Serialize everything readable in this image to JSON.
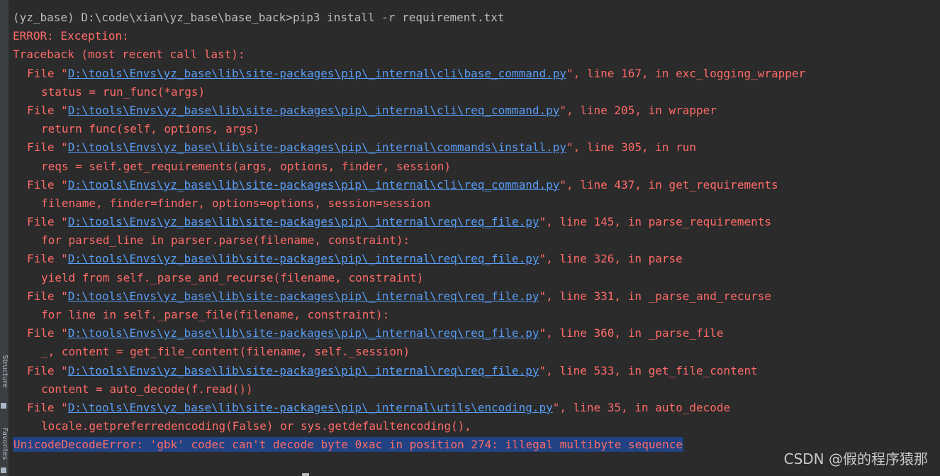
{
  "ide": {
    "left_tabs": [
      {
        "label": "Structure",
        "icon": "structure-icon"
      },
      {
        "label": "Favorites",
        "icon": "favorites-icon"
      }
    ]
  },
  "terminal": {
    "lines": [
      {
        "type": "prompt",
        "text": "(yz_base) D:\\code\\xian\\yz_base\\base_back>pip3 install -r requirement.txt"
      },
      {
        "type": "error",
        "text": "ERROR: Exception:"
      },
      {
        "type": "error",
        "text": "Traceback (most recent call last):"
      },
      {
        "type": "frame",
        "prefix": "File \"",
        "path": "D:\\tools\\Envs\\yz_base\\lib\\site-packages\\pip\\_internal\\cli\\base_command.py",
        "suffix": "\", line 167, in exc_logging_wrapper"
      },
      {
        "type": "code",
        "text": "status = run_func(*args)"
      },
      {
        "type": "frame",
        "prefix": "File \"",
        "path": "D:\\tools\\Envs\\yz_base\\lib\\site-packages\\pip\\_internal\\cli\\req_command.py",
        "suffix": "\", line 205, in wrapper"
      },
      {
        "type": "code",
        "text": "return func(self, options, args)"
      },
      {
        "type": "frame",
        "prefix": "File \"",
        "path": "D:\\tools\\Envs\\yz_base\\lib\\site-packages\\pip\\_internal\\commands\\install.py",
        "suffix": "\", line 305, in run"
      },
      {
        "type": "code",
        "text": "reqs = self.get_requirements(args, options, finder, session)"
      },
      {
        "type": "frame",
        "prefix": "File \"",
        "path": "D:\\tools\\Envs\\yz_base\\lib\\site-packages\\pip\\_internal\\cli\\req_command.py",
        "suffix": "\", line 437, in get_requirements"
      },
      {
        "type": "code",
        "text": "filename, finder=finder, options=options, session=session"
      },
      {
        "type": "frame",
        "prefix": "File \"",
        "path": "D:\\tools\\Envs\\yz_base\\lib\\site-packages\\pip\\_internal\\req\\req_file.py",
        "suffix": "\", line 145, in parse_requirements"
      },
      {
        "type": "code",
        "text": "for parsed_line in parser.parse(filename, constraint):"
      },
      {
        "type": "frame",
        "prefix": "File \"",
        "path": "D:\\tools\\Envs\\yz_base\\lib\\site-packages\\pip\\_internal\\req\\req_file.py",
        "suffix": "\", line 326, in parse"
      },
      {
        "type": "code",
        "text": "yield from self._parse_and_recurse(filename, constraint)"
      },
      {
        "type": "frame",
        "prefix": "File \"",
        "path": "D:\\tools\\Envs\\yz_base\\lib\\site-packages\\pip\\_internal\\req\\req_file.py",
        "suffix": "\", line 331, in _parse_and_recurse"
      },
      {
        "type": "code",
        "text": "for line in self._parse_file(filename, constraint):"
      },
      {
        "type": "frame",
        "prefix": "File \"",
        "path": "D:\\tools\\Envs\\yz_base\\lib\\site-packages\\pip\\_internal\\req\\req_file.py",
        "suffix": "\", line 360, in _parse_file"
      },
      {
        "type": "code",
        "text": "_, content = get_file_content(filename, self._session)"
      },
      {
        "type": "frame",
        "prefix": "File \"",
        "path": "D:\\tools\\Envs\\yz_base\\lib\\site-packages\\pip\\_internal\\req\\req_file.py",
        "suffix": "\", line 533, in get_file_content"
      },
      {
        "type": "code",
        "text": "content = auto_decode(f.read())"
      },
      {
        "type": "frame",
        "prefix": "File \"",
        "path": "D:\\tools\\Envs\\yz_base\\lib\\site-packages\\pip\\_internal\\utils\\encoding.py",
        "suffix": "\", line 35, in auto_decode"
      },
      {
        "type": "code",
        "text": "locale.getpreferredencoding(False) or sys.getdefaultencoding(),"
      },
      {
        "type": "final",
        "text": "UnicodeDecodeError: 'gbk' codec can't decode byte 0xac in position 274: illegal multibyte sequence"
      }
    ]
  },
  "watermark": {
    "text": "CSDN @假的程序猿那"
  },
  "colors": {
    "background": "#2b2b2b",
    "error": "#ff6b68",
    "path_link": "#589df6",
    "prompt": "#bbbbbb",
    "selection": "#214283"
  }
}
